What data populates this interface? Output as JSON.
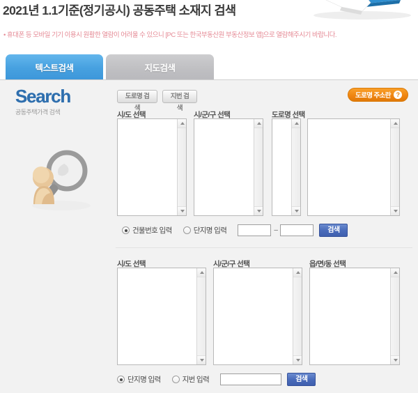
{
  "header": {
    "title": "2021년 1.1기준(정기공시) 공동주택 소재지 검색",
    "notice": "• 휴대폰 등 모바일 기기 이용시 원활한 열람이 어려울 수 있으니 [PC 또는 한국부동산원 부동산정보 앱]으로 열람해주시기 바랍니다."
  },
  "tabs": [
    {
      "label": "텍스트검색",
      "active": true
    },
    {
      "label": "지도검색",
      "active": false
    }
  ],
  "sidebar": {
    "logo_word": "Search",
    "logo_sub": "공동주택가격 검색"
  },
  "toolbar": {
    "road_search": "도로명 검색",
    "jibun_search": "지번 검색",
    "road_addr_guide": "도로명 주소란",
    "help_mark": "?"
  },
  "road_section": {
    "labels": {
      "sido": "시/도 선택",
      "sigungu": "시/군/구 선택",
      "roadname": "도로명 선택"
    },
    "lists": {
      "sido_items": [],
      "sigungu_items": [],
      "roadname_prefix_items": [],
      "roadname_items": []
    },
    "radios": [
      {
        "label": "건물번호 입력",
        "selected": true
      },
      {
        "label": "단지명 입력",
        "selected": false
      }
    ],
    "input_from": "",
    "input_to": "",
    "separator": "–",
    "search_label": "검색"
  },
  "jibun_section": {
    "labels": {
      "sido": "시/도 선택",
      "sigungu": "시/군/구 선택",
      "eupmyeondong": "읍/면/동 선택"
    },
    "lists": {
      "sido_items": [],
      "sigungu_items": [],
      "eupmyeondong_items": []
    },
    "radios": [
      {
        "label": "단지명 입력",
        "selected": true
      },
      {
        "label": "지번 입력",
        "selected": false
      }
    ],
    "input_value": "",
    "search_label": "검색"
  },
  "colors": {
    "tab_active": "#47a1e0",
    "tab_inactive": "#c0c0c3",
    "accent_orange": "#ef8410",
    "search_blue": "#4a6cbb",
    "notice_pink": "#e58a95",
    "panel_bg": "#f2f2f2"
  }
}
